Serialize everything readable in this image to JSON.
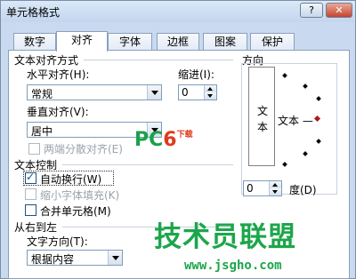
{
  "window": {
    "title": "单元格格式",
    "help_label": "?",
    "close_label": "✕"
  },
  "tabs": [
    {
      "label": "数字"
    },
    {
      "label": "对齐"
    },
    {
      "label": "字体"
    },
    {
      "label": "边框"
    },
    {
      "label": "图案"
    },
    {
      "label": "保护"
    }
  ],
  "text_alignment": {
    "section_label": "文本对齐方式",
    "horizontal_label": "水平对齐(H):",
    "horizontal_value": "常规",
    "indent_label": "缩进(I):",
    "indent_value": "0",
    "vertical_label": "垂直对齐(V):",
    "vertical_value": "居中",
    "distributed_label": "两端分散对齐(E)"
  },
  "text_control": {
    "section_label": "文本控制",
    "wrap_label": "自动换行(W)",
    "wrap_checked": true,
    "shrink_label": "缩小字体填充(K)",
    "merge_label": "合并单元格(M)"
  },
  "rtl": {
    "section_label": "从右到左",
    "direction_label": "文字方向(T):",
    "direction_value": "根据内容"
  },
  "orientation": {
    "section_label": "方向",
    "vertical_chars": [
      "文",
      "本"
    ],
    "horizontal_text": "文本 —",
    "degree_value": "0",
    "degree_label": "度(D)"
  },
  "watermark": {
    "pc": "PC",
    "six": "6",
    "xz": "下载",
    "big": "技术员联盟",
    "url": "www.jsgho.com"
  }
}
